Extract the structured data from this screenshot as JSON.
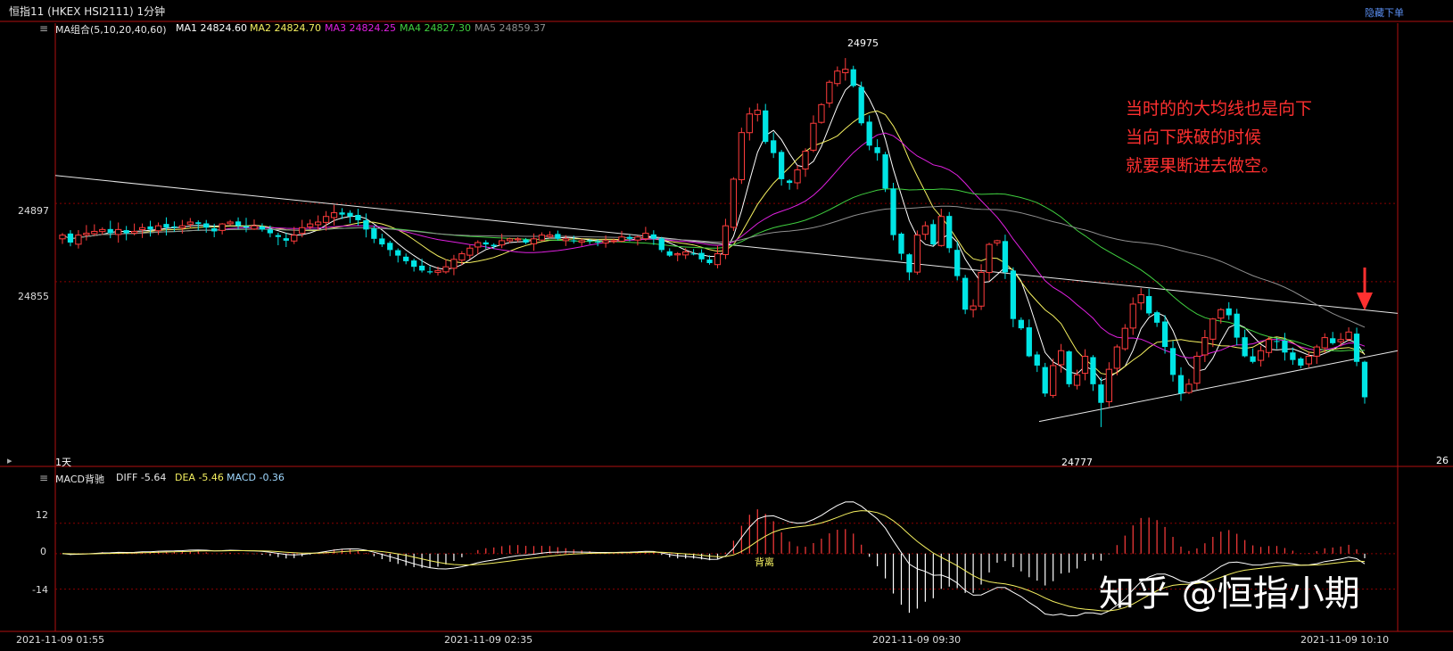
{
  "header": {
    "title": "恒指11 (HKEX HSI2111) 1分钟",
    "hide_order": "隐藏下单"
  },
  "ma_legend": {
    "group": "MA组合(5,10,20,40,60)",
    "ma1": "MA1 24824.60",
    "ma2": "MA2 24824.70",
    "ma3": "MA3 24824.25",
    "ma4": "MA4 24827.30",
    "ma5": "MA5 24859.37"
  },
  "macd_legend": {
    "name": "MACD背驰",
    "diff": "DIFF -5.64",
    "dea": "DEA -5.46",
    "macd": "MACD -0.36"
  },
  "colors": {
    "up": "#ff3c3c",
    "down": "#00e5e5",
    "ma1": "#ffffff",
    "ma2": "#f5f060",
    "ma3": "#e020e0",
    "ma4": "#40d040",
    "ma5": "#909090",
    "frame": "#b01010",
    "annotation": "#ff3030"
  },
  "labels": {
    "period": "1天",
    "right_count": "26",
    "high_price": "24975",
    "low_price": "24777",
    "macd_marker": "背离"
  },
  "annotation": {
    "line1": "当时的的大均线也是向下",
    "line2": "当向下跌破的时候",
    "line3": "就要果断进去做空。"
  },
  "watermark": "知乎 @恒指小期",
  "chart_data": [
    {
      "type": "candlestick",
      "title": "恒指11 (HKEX HSI2111) 1分钟",
      "ylim": [
        24765,
        24987
      ],
      "y_ticks": [
        24897,
        24855
      ],
      "x_ticks": [
        "2021-11-09 01:55",
        "2021-11-09 02:35",
        "2021-11-09 09:30",
        "2021-11-09 10:10"
      ],
      "marked_high": 24975,
      "marked_low": 24777,
      "series": [
        {
          "name": "MA1",
          "last": 24824.6
        },
        {
          "name": "MA2",
          "last": 24824.7
        },
        {
          "name": "MA3",
          "last": 24824.25
        },
        {
          "name": "MA4",
          "last": 24827.3
        },
        {
          "name": "MA5",
          "last": 24859.37
        }
      ],
      "close": [
        24880,
        24876,
        24880,
        24881,
        24882,
        24883,
        24881,
        24883,
        24881,
        24882,
        24884,
        24883,
        24885,
        24884,
        24884,
        24885,
        24887,
        24886,
        24884,
        24882,
        24886,
        24887,
        24885,
        24884,
        24885,
        24883,
        24881,
        24879,
        24877,
        24880,
        24884,
        24886,
        24887,
        24890,
        24892,
        24891,
        24890,
        24888,
        24883,
        24878,
        24875,
        24872,
        24869,
        24866,
        24863,
        24861,
        24860,
        24861,
        24863,
        24867,
        24870,
        24873,
        24876,
        24875,
        24874,
        24877,
        24878,
        24878,
        24876,
        24878,
        24880,
        24880,
        24878,
        24878,
        24877,
        24877,
        24877,
        24876,
        24877,
        24877,
        24879,
        24878,
        24879,
        24881,
        24878,
        24872,
        24869,
        24870,
        24871,
        24870,
        24867,
        24865,
        24870,
        24885,
        24910,
        24935,
        24945,
        24947,
        24930,
        24924,
        24910,
        24908,
        24915,
        24925,
        24940,
        24950,
        24962,
        24968,
        24969,
        24960,
        24940,
        24928,
        24924,
        24905,
        24880,
        24870,
        24860,
        24880,
        24885,
        24875,
        24890,
        24873,
        24858,
        24840,
        24842,
        24860,
        24875,
        24877,
        24860,
        24835,
        24830,
        24815,
        24810,
        24795,
        24810,
        24818,
        24800,
        24805,
        24815,
        24800,
        24790,
        24808,
        24820,
        24830,
        24843,
        24848,
        24838,
        24833,
        24820,
        24805,
        24795,
        24800,
        24815,
        24825,
        24835,
        24840,
        24837,
        24825,
        24815,
        24812,
        24818,
        24824,
        24823,
        24817,
        24813,
        24810,
        24815,
        24820,
        24825,
        24822,
        24824,
        24828,
        24812,
        24793
      ],
      "macd_panel": {
        "ylim": [
          -30,
          32
        ],
        "y_ticks": [
          12,
          0,
          -14
        ],
        "diff_last": -5.64,
        "dea_last": -5.46,
        "macd_last": -0.36,
        "divergence_label": "背离"
      }
    }
  ]
}
